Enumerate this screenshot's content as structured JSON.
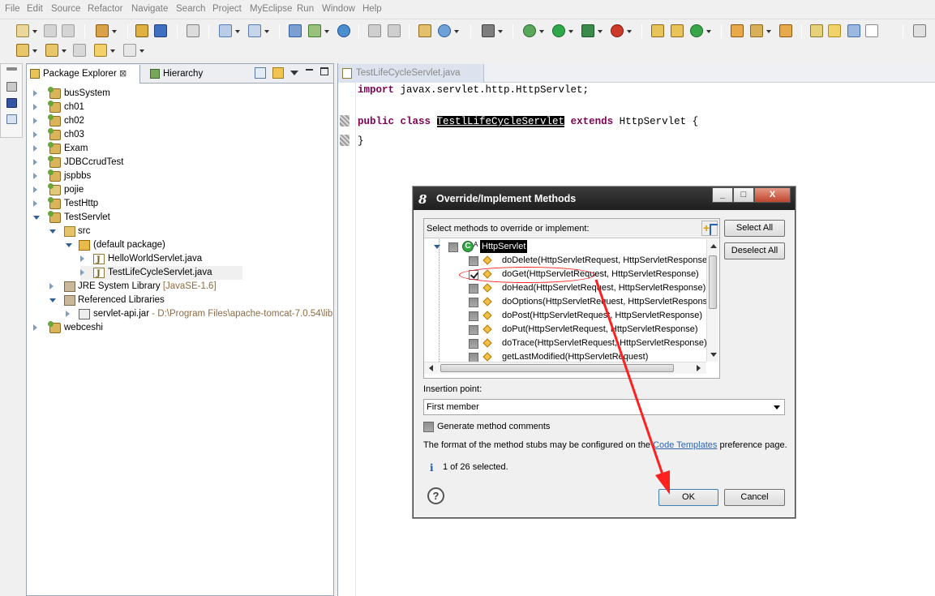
{
  "menu": [
    "File",
    "Edit",
    "Source",
    "Refactor",
    "Navigate",
    "Search",
    "Project",
    "MyEclipse",
    "Run",
    "Window",
    "Help"
  ],
  "colors": {
    "accent": "#7f0055",
    "selection": "#000000",
    "annotation": "#ff2020",
    "link": "#2d64b3"
  },
  "package_explorer": {
    "tab_label": "Package Explorer",
    "close_glyph": "⊠",
    "hierarchy_tab_label": "Hierarchy",
    "items": [
      {
        "label": "busSystem",
        "deco": ""
      },
      {
        "label": "ch01",
        "deco": ""
      },
      {
        "label": "ch02",
        "deco": ""
      },
      {
        "label": "ch03",
        "deco": ""
      },
      {
        "label": "Exam",
        "deco": ""
      },
      {
        "label": "JDBCcrudTest",
        "deco": ""
      },
      {
        "label": "jspbbs",
        "deco": ""
      },
      {
        "label": "pojie",
        "deco": ""
      },
      {
        "label": "TestHttp",
        "deco": ""
      },
      {
        "label": "TestServlet",
        "deco": ""
      },
      {
        "label": "src",
        "deco": ""
      },
      {
        "label": "(default package)",
        "deco": ""
      },
      {
        "label": "HelloWorldServlet.java",
        "deco": ""
      },
      {
        "label": "TestLifeCycleServlet.java",
        "deco": ""
      },
      {
        "label": "JRE System Library",
        "deco": "[JavaSE-1.6]"
      },
      {
        "label": "Referenced Libraries",
        "deco": ""
      },
      {
        "label": "servlet-api.jar",
        "deco": "- D:\\Program Files\\apache-tomcat-7.0.54\\lib"
      },
      {
        "label": "webceshi",
        "deco": ""
      }
    ]
  },
  "editor": {
    "tab_label": "TestLifeCycleServlet.java",
    "lines": {
      "l1_kw": "import",
      "l1_rest": " javax.servlet.http.HttpServlet;",
      "l2_kw1": "public class",
      "l2_name": "TestlLifeCycleServlet",
      "l2_kw2": "extends",
      "l2_rest": " HttpServlet {",
      "l3": "}"
    }
  },
  "dialog": {
    "title": "Override/Implement Methods",
    "select_label": "Select methods to override or implement:",
    "select_all": "Select All",
    "deselect_all": "Deselect All",
    "class_name": "HttpServlet",
    "class_sup": "A",
    "methods": [
      {
        "label": "doDelete(HttpServletRequest, HttpServletResponse)",
        "checked": false
      },
      {
        "label": "doGet(HttpServletRequest, HttpServletResponse)",
        "checked": true
      },
      {
        "label": "doHead(HttpServletRequest, HttpServletResponse)",
        "checked": false
      },
      {
        "label": "doOptions(HttpServletRequest, HttpServletResponse)",
        "checked": false
      },
      {
        "label": "doPost(HttpServletRequest, HttpServletResponse)",
        "checked": false
      },
      {
        "label": "doPut(HttpServletRequest, HttpServletResponse)",
        "checked": false
      },
      {
        "label": "doTrace(HttpServletRequest, HttpServletResponse)",
        "checked": false
      },
      {
        "label": "getLastModified(HttpServletRequest)",
        "checked": false
      }
    ],
    "insertion_label": "Insertion point:",
    "insertion_value": "First member",
    "gen_comments": "Generate method comments",
    "format_prefix": "The format of the method stubs may be configured on the ",
    "format_link": "Code Templates",
    "format_suffix": " preference page.",
    "info_glyph": "i",
    "status": "1 of 26 selected.",
    "help_glyph": "?",
    "ok": "OK",
    "cancel": "Cancel",
    "win_min": "_",
    "win_max": "□",
    "win_close": "X"
  }
}
